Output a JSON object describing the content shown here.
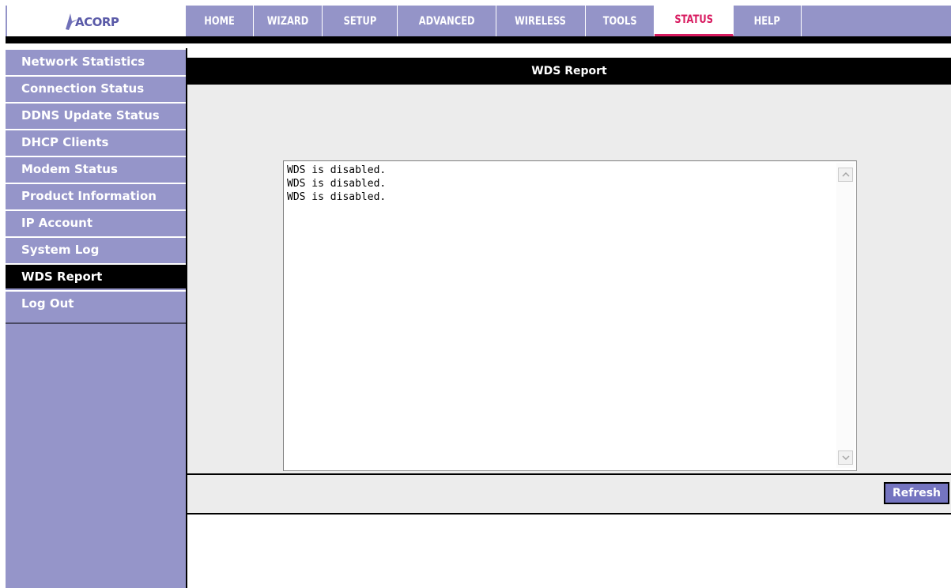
{
  "brand": {
    "logo_text": "ACORP"
  },
  "nav": {
    "tabs": [
      {
        "label": "HOME"
      },
      {
        "label": "WIZARD"
      },
      {
        "label": "SETUP"
      },
      {
        "label": "ADVANCED"
      },
      {
        "label": "WIRELESS"
      },
      {
        "label": "TOOLS"
      },
      {
        "label": "STATUS",
        "active": true
      },
      {
        "label": "HELP"
      }
    ]
  },
  "sidebar": {
    "items": [
      {
        "label": "Network Statistics"
      },
      {
        "label": "Connection Status"
      },
      {
        "label": "DDNS Update Status"
      },
      {
        "label": "DHCP Clients"
      },
      {
        "label": "Modem Status"
      },
      {
        "label": "Product Information"
      },
      {
        "label": "IP Account"
      },
      {
        "label": "System Log"
      },
      {
        "label": "WDS Report",
        "active": true
      },
      {
        "label": "Log Out"
      }
    ]
  },
  "main": {
    "title": "WDS Report",
    "report_lines": [
      "WDS is disabled.",
      "WDS is disabled.",
      "WDS is disabled."
    ],
    "refresh_label": "Refresh"
  },
  "colors": {
    "nav_bg": "#9494c8",
    "active_accent": "#d81b60",
    "sidebar_bg": "#9595c9",
    "button_bg": "#7474c0"
  }
}
